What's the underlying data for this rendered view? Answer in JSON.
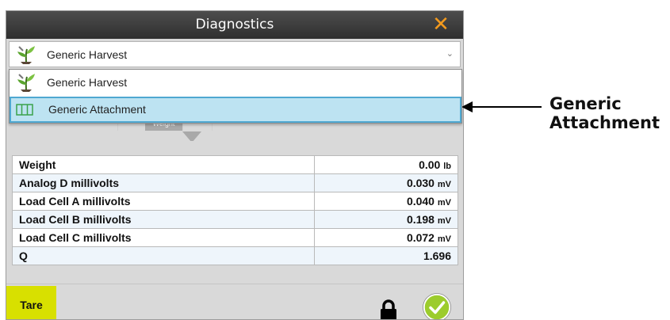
{
  "window": {
    "title": "Diagnostics",
    "close_glyph": "✕"
  },
  "profile_select": {
    "selected_value": "Generic Harvest",
    "chevron_glyph": "⌄"
  },
  "dropdown": {
    "options": [
      {
        "label": "Generic Harvest",
        "icon": "harvest-plant-icon"
      },
      {
        "label": "Generic Attachment",
        "icon": "attachment-book-icon"
      }
    ],
    "highlighted_option": "Generic Attachment"
  },
  "tabs_partially_visible": [
    "Weight"
  ],
  "metrics": {
    "rows": [
      {
        "label": "Weight",
        "value": "0.00",
        "unit": "lb"
      },
      {
        "label": "Analog D millivolts",
        "value": "0.030",
        "unit": "mV"
      },
      {
        "label": "Load Cell A millivolts",
        "value": "0.040",
        "unit": "mV"
      },
      {
        "label": "Load Cell B millivolts",
        "value": "0.198",
        "unit": "mV"
      },
      {
        "label": "Load Cell C millivolts",
        "value": "0.072",
        "unit": "mV"
      },
      {
        "label": "Q",
        "value": "1.696",
        "unit": ""
      }
    ]
  },
  "footer": {
    "tare_label": "Tare",
    "lock_icon": "lock-icon",
    "confirm_icon": "checkmark-circle-icon"
  },
  "annotation": {
    "line1": "Generic",
    "line2": "Attachment"
  },
  "colors": {
    "titlebar": "#3c3c3c",
    "close_accent": "#f39a1e",
    "highlight_bg": "#bde3f2",
    "highlight_border": "#4fa8d1",
    "tare_button": "#d8e000",
    "confirm_green": "#9ccc2d"
  }
}
